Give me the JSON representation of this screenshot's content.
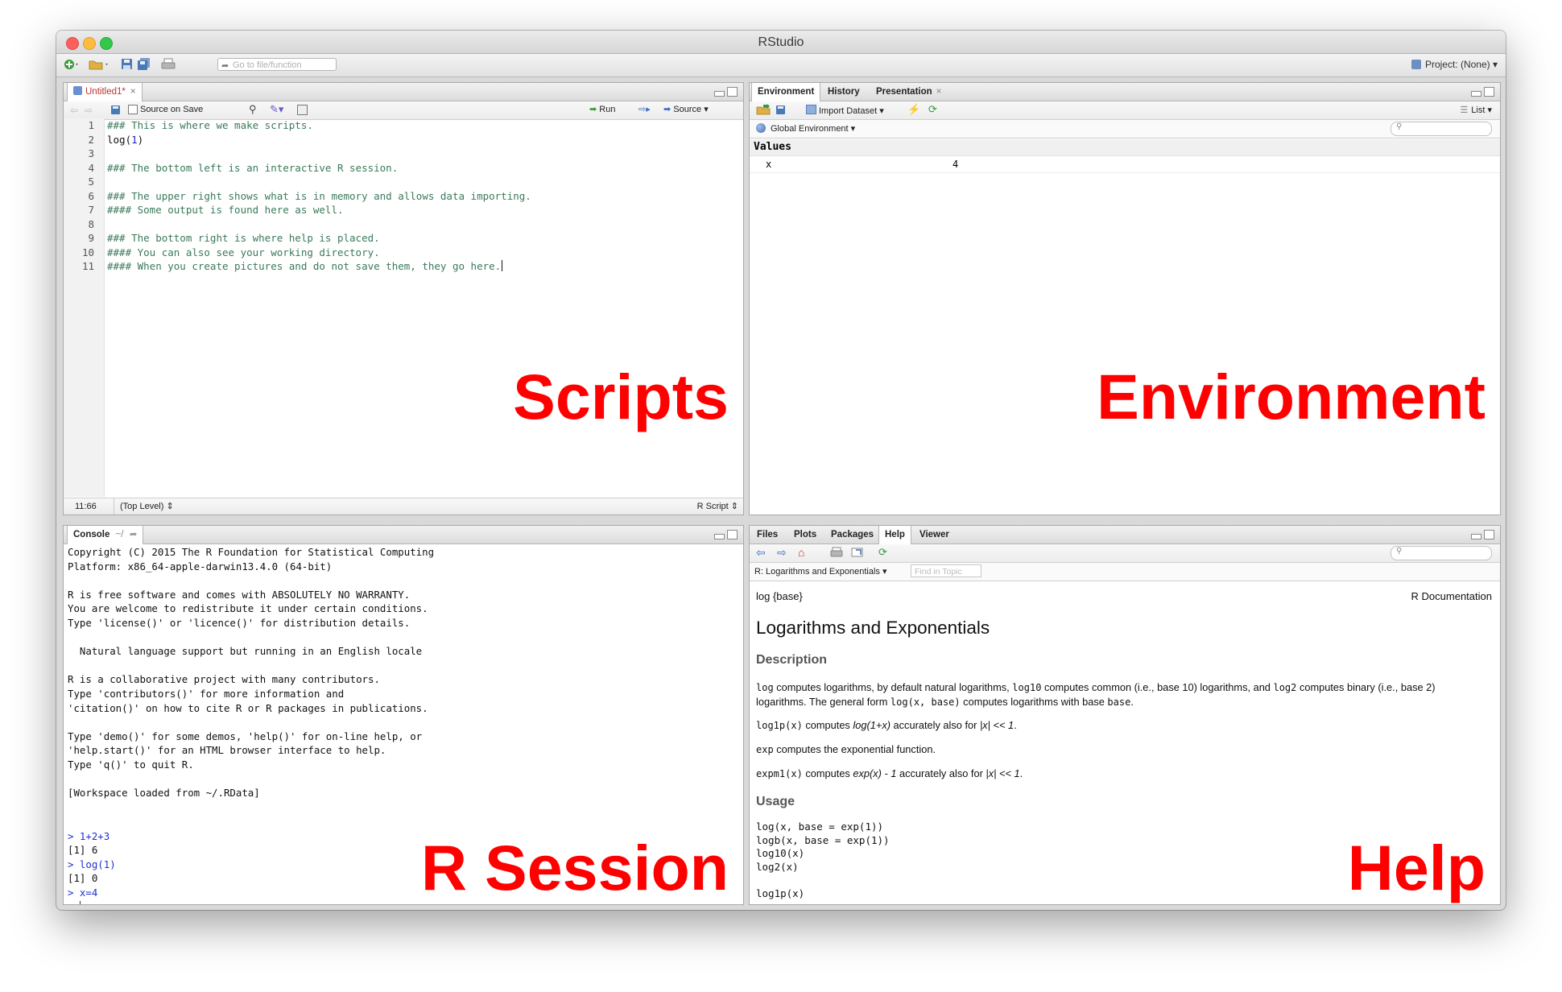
{
  "window": {
    "title": "RStudio"
  },
  "toolbar": {
    "goto_placeholder": "Go to file/function",
    "project": "Project: (None) ▾"
  },
  "source": {
    "tab_label": "Untitled1*",
    "source_on_save": "Source on Save",
    "run": "Run",
    "source": "Source",
    "status_pos": "11:66",
    "status_scope": "(Top Level) ⇕",
    "status_type": "R Script ⇕",
    "line_numbers": [
      "1",
      "2",
      "3",
      "4",
      "5",
      "6",
      "7",
      "8",
      "9",
      "10",
      "11"
    ],
    "lines": [
      "### This is where we make scripts.",
      "log(1)",
      "",
      "### The bottom left is an interactive R session.",
      "",
      "### The upper right shows what is in memory and allows data importing.",
      "#### Some output is found here as well.",
      "",
      "### The bottom right is where help is placed.",
      "#### You can also see your working directory.",
      "#### When you create pictures and do not save them, they go here."
    ],
    "line2_fn": "log(",
    "line2_arg": "1",
    "line2_close": ")",
    "overlay": "Scripts"
  },
  "environment": {
    "tabs": [
      "Environment",
      "History",
      "Presentation"
    ],
    "import_dataset": "Import Dataset ▾",
    "list_view": "List ▾",
    "global_env": "Global Environment ▾",
    "values_header": "Values",
    "var_name": "x",
    "var_value": "4",
    "overlay": "Environment"
  },
  "console": {
    "tab": "Console",
    "path": "~/",
    "startup": "Copyright (C) 2015 The R Foundation for Statistical Computing\nPlatform: x86_64-apple-darwin13.4.0 (64-bit)\n\nR is free software and comes with ABSOLUTELY NO WARRANTY.\nYou are welcome to redistribute it under certain conditions.\nType 'license()' or 'licence()' for distribution details.\n\n  Natural language support but running in an English locale\n\nR is a collaborative project with many contributors.\nType 'contributors()' for more information and\n'citation()' on how to cite R or R packages in publications.\n\nType 'demo()' for some demos, 'help()' for on-line help, or\n'help.start()' for an HTML browser interface to help.\nType 'q()' to quit R.\n\n[Workspace loaded from ~/.RData]\n",
    "cmd1": "> 1+2+3",
    "out1": "[1] 6",
    "cmd2": "> log(1)",
    "out2": "[1] 0",
    "cmd3": "> x=4",
    "prompt": "> ",
    "overlay": "R Session"
  },
  "help": {
    "tabs": [
      "Files",
      "Plots",
      "Packages",
      "Help",
      "Viewer"
    ],
    "topic": "R: Logarithms and Exponentials ▾",
    "find_placeholder": "Find in Topic",
    "fn_ref": "log {base}",
    "r_doc": "R Documentation",
    "title": "Logarithms and Exponentials",
    "desc_heading": "Description",
    "desc_p1_code1": "log",
    "desc_p1_t1": " computes logarithms, by default natural logarithms, ",
    "desc_p1_code2": "log10",
    "desc_p1_t2": " computes common (i.e., base 10) logarithms, and ",
    "desc_p1_code3": "log2",
    "desc_p1_t3": " computes binary (i.e., base 2) logarithms. The general form ",
    "desc_p1_code4": "log(x, base)",
    "desc_p1_t4": " computes logarithms with base ",
    "desc_p1_code5": "base",
    "desc_p1_t5": ".",
    "desc_p2_code": "log1p(x)",
    "desc_p2_t1": " computes ",
    "desc_p2_em1": "log(1+x)",
    "desc_p2_t2": " accurately also for ",
    "desc_p2_em2": "|x| << 1",
    "desc_p2_t3": ".",
    "desc_p3_code": "exp",
    "desc_p3_t": " computes the exponential function.",
    "desc_p4_code": "expm1(x)",
    "desc_p4_t1": " computes ",
    "desc_p4_em1": "exp(x) - 1",
    "desc_p4_t2": " accurately also for ",
    "desc_p4_em2": "|x| << 1",
    "desc_p4_t3": ".",
    "usage_heading": "Usage",
    "usage_code": "log(x, base = exp(1))\nlogb(x, base = exp(1))\nlog10(x)\nlog2(x)\n\nlog1p(x)",
    "overlay": "Help"
  },
  "colors": {
    "comment": "#3a7a5a",
    "number": "#1e1eb4",
    "console_cmd": "#1e2fd0",
    "overlay": "#ff0000"
  }
}
